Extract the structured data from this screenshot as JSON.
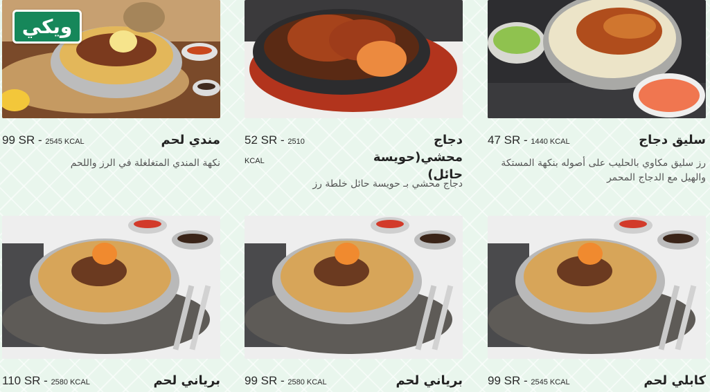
{
  "brand": {
    "logo_text": "ويكي"
  },
  "menu_items": [
    {
      "name": "سليق دجاج",
      "price": "47 SR",
      "kcal": "1440 KCAL",
      "description": "رز سليق مكاوي بالحليب على أصوله بنكهة المستكة والهيل مع الدجاج المحمر"
    },
    {
      "name": "دجاج محشي(حويسة حائل)",
      "price": "52 SR",
      "kcal": "2510 KCAL",
      "description": "دجاج محشي بـ حويسة حائل خلطة رز"
    },
    {
      "name": "مندي لحم",
      "price": "99 SR",
      "kcal": "2545 KCAL",
      "description": "نكهة المندي المتغلغلة في الرز واللحم"
    },
    {
      "name": "كابلي لحم",
      "price": "99 SR",
      "kcal": "2545 KCAL",
      "description": ""
    },
    {
      "name": "برياني لحم",
      "price": "99 SR",
      "kcal": "2580 KCAL",
      "description": ""
    },
    {
      "name": "برياني لحم",
      "price": "110 SR",
      "kcal": "2580 KCAL",
      "description": ""
    }
  ]
}
